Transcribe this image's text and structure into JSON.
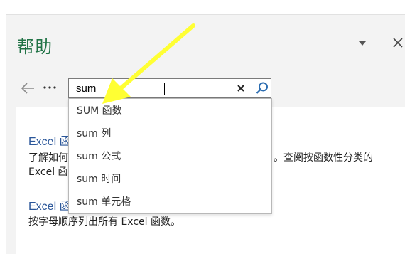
{
  "pane": {
    "title": "帮助",
    "options_icon": "chevron-down-icon",
    "close_icon": "close-icon"
  },
  "nav": {
    "back_icon": "back-arrow-icon",
    "more_label": "···"
  },
  "search": {
    "value": "sum",
    "clear_icon": "close-icon",
    "search_icon": "search-icon"
  },
  "suggestions": [
    "SUM 函数",
    "sum 列",
    "sum 公式",
    "sum 时间",
    "sum 单元格"
  ],
  "results": [
    {
      "title": "Excel 函",
      "desc_line1": "了解如何",
      "desc_tail": "。查阅按函数性分类的",
      "desc_line2": "Excel 函"
    },
    {
      "title": "Excel 函",
      "desc_line1": "按字母顺序列出所有 Excel 函数。"
    }
  ],
  "colors": {
    "title_green": "#217346",
    "link_blue": "#2b579a",
    "annotation_yellow": "#ffff33"
  }
}
